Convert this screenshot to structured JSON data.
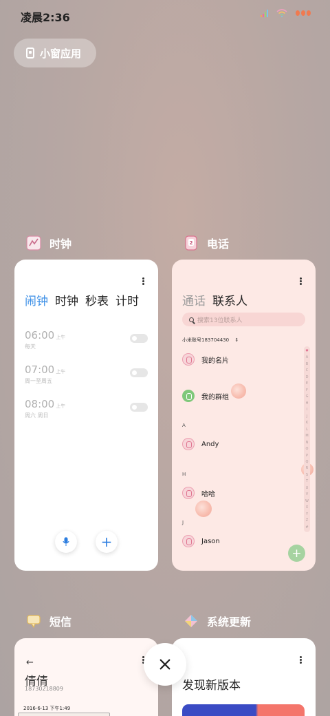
{
  "status": {
    "time": "凌晨2:36"
  },
  "floating": {
    "label": "小窗应用"
  },
  "clock": {
    "title": "时钟",
    "tabs": [
      "闹钟",
      "时钟",
      "秒表",
      "计时"
    ],
    "alarms": [
      {
        "time": "06:00",
        "ampm": "上午",
        "repeat": "每天",
        "enabled": false
      },
      {
        "time": "07:00",
        "ampm": "上午",
        "repeat": "周一至周五",
        "enabled": false
      },
      {
        "time": "08:00",
        "ampm": "上午",
        "repeat": "周六 周日",
        "enabled": false
      }
    ]
  },
  "phone": {
    "title": "电话",
    "tabs": [
      "通话",
      "联系人"
    ],
    "search_placeholder": "搜索13位联系人",
    "account": "小米账号183704430",
    "my_card": "我的名片",
    "my_groups": "我的群组",
    "sections": [
      {
        "letter": "A",
        "name": "Andy"
      },
      {
        "letter": "H",
        "name": "哈哈"
      },
      {
        "letter": "J",
        "name": "Jason"
      }
    ],
    "alphabet": [
      "♥",
      "A",
      "B",
      "C",
      "D",
      "E",
      "F",
      "G",
      "H",
      "I",
      "J",
      "K",
      "L",
      "M",
      "N",
      "O",
      "P",
      "Q",
      "R",
      "S",
      "T",
      "U",
      "V",
      "W",
      "X",
      "Y",
      "Z",
      "#"
    ]
  },
  "messages": {
    "title": "短信",
    "contact": "倩倩",
    "number": "18730218809",
    "date": "2016-6-13 下午1:49"
  },
  "update": {
    "title": "系统更新",
    "headline": "发现新版本"
  },
  "colors": {
    "accent": "#3a8ee6",
    "fab": "#a6d3a1",
    "phone_bg": "#fde9e5"
  }
}
